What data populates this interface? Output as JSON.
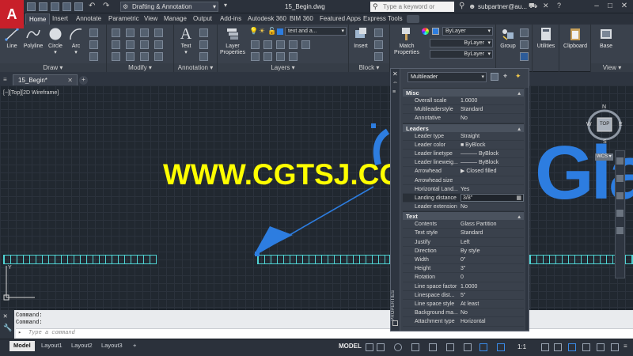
{
  "app": {
    "logo": "A",
    "workspace": "Drafting & Annotation",
    "title": "15_Begin.dwg",
    "search_placeholder": "Type a keyword or phrase",
    "user": "subpartner@au..."
  },
  "ribbon_tabs": [
    "Home",
    "Insert",
    "Annotate",
    "Parametric",
    "View",
    "Manage",
    "Output",
    "Add-ins",
    "Autodesk 360",
    "BIM 360",
    "Featured Apps",
    "Express Tools"
  ],
  "ribbon": {
    "draw": {
      "label": "Draw",
      "tools": [
        "Line",
        "Polyline",
        "Circle",
        "Arc"
      ]
    },
    "modify": {
      "label": "Modify"
    },
    "annotation": {
      "label": "Annotation",
      "text_tool": "Text"
    },
    "layers": {
      "label": "Layers",
      "layer_props": "Layer Properties",
      "current_layer": "text and a..."
    },
    "block": {
      "label": "Block",
      "insert": "Insert"
    },
    "properties": {
      "match": "Match Properties",
      "color": "ByLayer",
      "linetype": "ByLayer",
      "lineweight": "ByLayer"
    },
    "groups": {
      "group": "Group"
    },
    "utilities": "Utilities",
    "clipboard": "Clipboard",
    "view": {
      "base": "Base",
      "label": "View"
    }
  },
  "doc_tab": "15_Begin*",
  "viewport_label": "[−][Top][2D Wireframe]",
  "watermark": "WWW.CGTSJ.COM",
  "drawing_text": "GlaSS",
  "viewcube": {
    "top": "TOP",
    "n": "N",
    "s": "S",
    "e": "E",
    "w": "W",
    "wcs": "WCS"
  },
  "command": {
    "history": [
      "Command:",
      "Command:"
    ],
    "placeholder": "Type a command"
  },
  "layout_tabs": [
    "Model",
    "Layout1",
    "Layout2",
    "Layout3"
  ],
  "status": {
    "model": "MODEL",
    "scale": "1:1"
  },
  "properties": {
    "selection": "Multileader",
    "strip_label": "PROPERTIES",
    "sections": [
      {
        "title": "Misc",
        "rows": [
          {
            "k": "Overall scale",
            "v": "1.0000"
          },
          {
            "k": "Multileaderstyle",
            "v": "Standard"
          },
          {
            "k": "Annotative",
            "v": "No"
          }
        ]
      },
      {
        "title": "Leaders",
        "rows": [
          {
            "k": "Leader type",
            "v": "Straight"
          },
          {
            "k": "Leader color",
            "v": "■ ByBlock"
          },
          {
            "k": "Leader linetype",
            "v": "——— ByBlock"
          },
          {
            "k": "Leader lineweig...",
            "v": "——— ByBlock"
          },
          {
            "k": "Arrowhead",
            "v": "▶ Closed filled"
          },
          {
            "k": "Arrowhead size",
            "v": ""
          },
          {
            "k": "Horizontal Land...",
            "v": "Yes"
          },
          {
            "k": "Landing distance",
            "v": "3/8\""
          },
          {
            "k": "Leader extension",
            "v": "No"
          }
        ]
      },
      {
        "title": "Text",
        "rows": [
          {
            "k": "Contents",
            "v": "Glass Partition"
          },
          {
            "k": "Text style",
            "v": "Standard"
          },
          {
            "k": "Justify",
            "v": "Left"
          },
          {
            "k": "Direction",
            "v": "By style"
          },
          {
            "k": "Width",
            "v": "0\""
          },
          {
            "k": "Height",
            "v": "3\""
          },
          {
            "k": "Rotation",
            "v": "0"
          },
          {
            "k": "Line space factor",
            "v": "1.0000"
          },
          {
            "k": "Linespace dist...",
            "v": "5\""
          },
          {
            "k": "Line space style",
            "v": "At least"
          },
          {
            "k": "Background ma...",
            "v": "No"
          },
          {
            "k": "Attachment type",
            "v": "Horizontal"
          }
        ]
      }
    ]
  }
}
